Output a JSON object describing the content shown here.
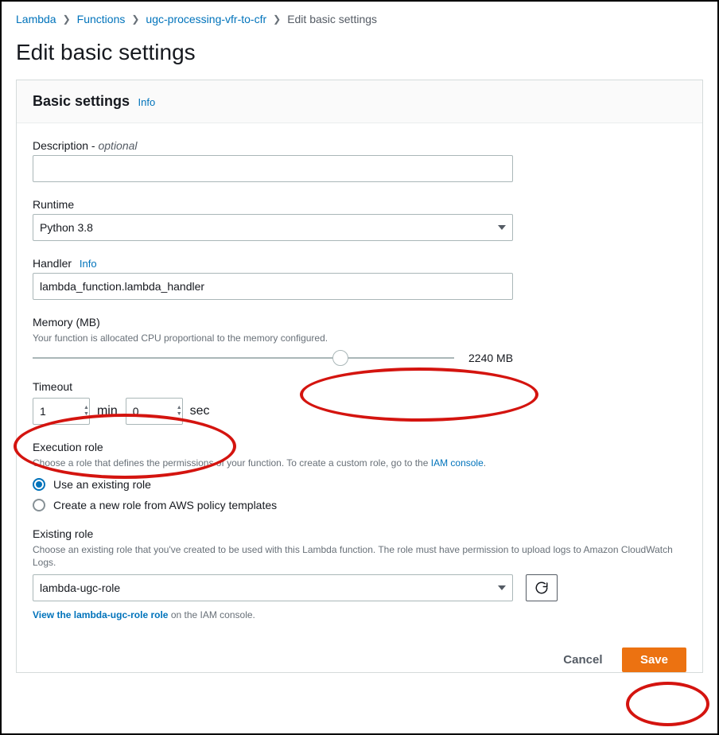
{
  "breadcrumb": {
    "items": [
      "Lambda",
      "Functions",
      "ugc-processing-vfr-to-cfr"
    ],
    "current": "Edit basic settings"
  },
  "page": {
    "title": "Edit basic settings"
  },
  "panel": {
    "title": "Basic settings",
    "info": "Info"
  },
  "description": {
    "label_prefix": "Description",
    "label_dash": " - ",
    "label_suffix": "optional",
    "value": ""
  },
  "runtime": {
    "label": "Runtime",
    "value": "Python 3.8"
  },
  "handler": {
    "label": "Handler",
    "info": "Info",
    "value": "lambda_function.lambda_handler"
  },
  "memory": {
    "label": "Memory (MB)",
    "helper": "Your function is allocated CPU proportional to the memory configured.",
    "value": 2240,
    "display": "2240 MB",
    "max_mb": 3008,
    "percent": 0.73
  },
  "timeout": {
    "label": "Timeout",
    "min_value": "1",
    "min_unit": "min",
    "sec_value": "0",
    "sec_unit": "sec"
  },
  "execution_role": {
    "label": "Execution role",
    "helper_prefix": "Choose a role that defines the permissions of your function. To create a custom role, go to the ",
    "helper_link": "IAM console",
    "helper_suffix": ".",
    "opt_existing": "Use an existing role",
    "opt_create": "Create a new role from AWS policy templates"
  },
  "existing_role": {
    "label": "Existing role",
    "helper": "Choose an existing role that you've created to be used with this Lambda function. The role must have permission to upload logs to Amazon CloudWatch Logs.",
    "value": "lambda-ugc-role",
    "view_link": "View the lambda-ugc-role role",
    "view_suffix": " on the IAM console."
  },
  "buttons": {
    "cancel": "Cancel",
    "save": "Save"
  }
}
